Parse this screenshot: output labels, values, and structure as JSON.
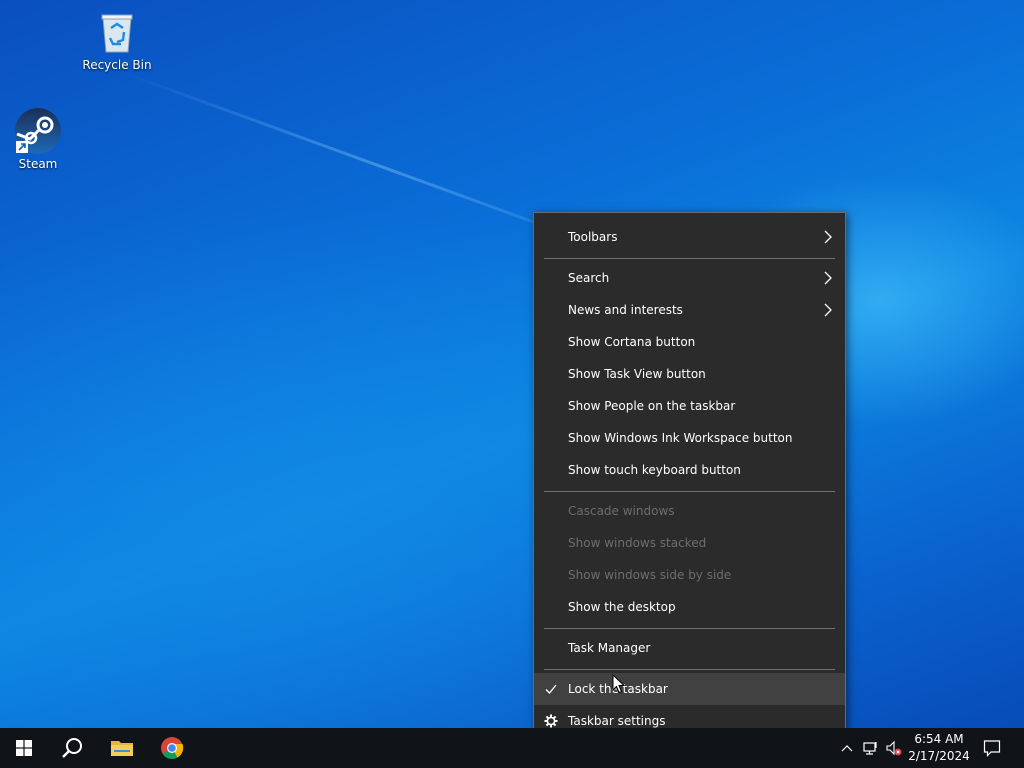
{
  "desktop": {
    "icons": [
      {
        "label": "Recycle Bin",
        "icon": "recycle-bin-icon"
      },
      {
        "label": "Steam",
        "icon": "steam-icon"
      }
    ]
  },
  "context_menu": {
    "items": [
      {
        "label": "Toolbars",
        "submenu": true,
        "enabled": true
      },
      {
        "label": "Search",
        "submenu": true,
        "enabled": true
      },
      {
        "label": "News and interests",
        "submenu": true,
        "enabled": true
      },
      {
        "label": "Show Cortana button",
        "enabled": true
      },
      {
        "label": "Show Task View button",
        "enabled": true
      },
      {
        "label": "Show People on the taskbar",
        "enabled": true
      },
      {
        "label": "Show Windows Ink Workspace button",
        "enabled": true
      },
      {
        "label": "Show touch keyboard button",
        "enabled": true
      },
      {
        "label": "Cascade windows",
        "enabled": false
      },
      {
        "label": "Show windows stacked",
        "enabled": false
      },
      {
        "label": "Show windows side by side",
        "enabled": false
      },
      {
        "label": "Show the desktop",
        "enabled": true
      },
      {
        "label": "Task Manager",
        "enabled": true
      },
      {
        "label": "Lock the taskbar",
        "enabled": true,
        "checked": true,
        "highlighted": true
      },
      {
        "label": "Taskbar settings",
        "enabled": true,
        "icon": "gear-icon"
      }
    ]
  },
  "taskbar": {
    "buttons": [
      {
        "name": "start-button",
        "icon": "windows-logo-icon"
      },
      {
        "name": "search-button",
        "icon": "search-icon"
      },
      {
        "name": "file-explorer-button",
        "icon": "folder-icon"
      },
      {
        "name": "chrome-button",
        "icon": "chrome-icon"
      }
    ],
    "tray": {
      "icons": [
        "chevron-up-icon",
        "network-disconnected-icon",
        "volume-muted-icon"
      ],
      "time": "6:54 AM",
      "date": "2/17/2024",
      "notifications_icon": "notification-icon"
    }
  },
  "colors": {
    "menu_bg": "#2b2b2b",
    "menu_hover": "#414141",
    "menu_disabled_text": "#6d6d6d",
    "taskbar_bg": "#101418"
  }
}
